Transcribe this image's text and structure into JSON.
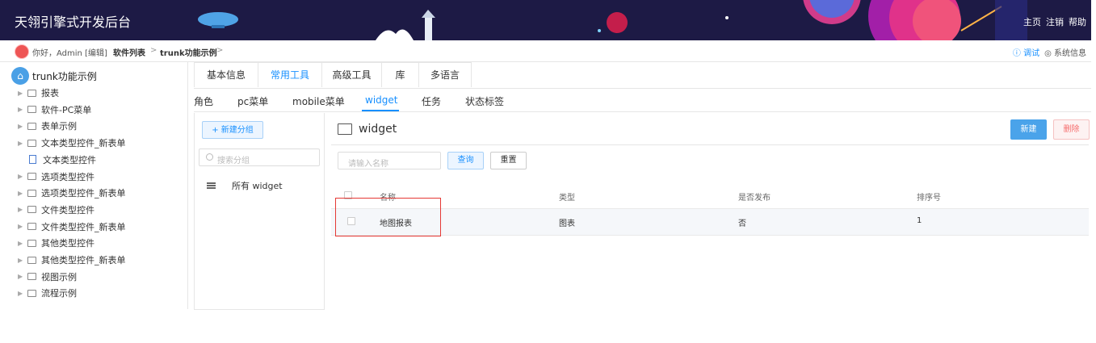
{
  "header": {
    "title": "天翎引擎式开发后台",
    "links": [
      "主页",
      "注销",
      "帮助"
    ]
  },
  "breadcrumb": {
    "greeting": "你好，Admin [编辑]",
    "crumb1": "软件列表",
    "crumb2": "trunk功能示例",
    "separator": ">",
    "debug": "ⓘ 调试",
    "sysinfo": "◎ 系统信息"
  },
  "sidebar": {
    "root": "trunk功能示例",
    "items": [
      {
        "label": "报表",
        "type": "folder"
      },
      {
        "label": "软件-PC菜单",
        "type": "folder"
      },
      {
        "label": "表单示例",
        "type": "folder"
      },
      {
        "label": "文本类型控件_新表单",
        "type": "folder"
      },
      {
        "label": "文本类型控件",
        "type": "doc"
      },
      {
        "label": "选项类型控件",
        "type": "folder"
      },
      {
        "label": "选项类型控件_新表单",
        "type": "folder"
      },
      {
        "label": "文件类型控件",
        "type": "folder"
      },
      {
        "label": "文件类型控件_新表单",
        "type": "folder"
      },
      {
        "label": "其他类型控件",
        "type": "folder"
      },
      {
        "label": "其他类型控件_新表单",
        "type": "folder"
      },
      {
        "label": "视图示例",
        "type": "folder"
      },
      {
        "label": "流程示例",
        "type": "folder"
      }
    ]
  },
  "tabs": [
    "基本信息",
    "常用工具",
    "高级工具",
    "库",
    "多语言"
  ],
  "subtabs": [
    "角色",
    "pc菜单",
    "mobile菜单",
    "widget",
    "任务",
    "状态标签"
  ],
  "group_panel": {
    "new_group": "+ 新建分组",
    "search_placeholder": "搜索分组",
    "all_widget": "所有 widget"
  },
  "content": {
    "title": "widget",
    "new_button": "新建",
    "delete_button": "删除",
    "name_placeholder": "请输入名称",
    "query_button": "查询",
    "reset_button": "重置"
  },
  "table": {
    "columns": [
      "名称",
      "类型",
      "是否发布",
      "排序号"
    ],
    "rows": [
      {
        "name": "地图报表",
        "type": "图表",
        "published": "否",
        "order": "1"
      }
    ]
  },
  "colors": {
    "header_bg": "#1d1a45",
    "accent": "#1890ff",
    "danger": "#f56c6c",
    "highlight_box": "#e53935"
  }
}
